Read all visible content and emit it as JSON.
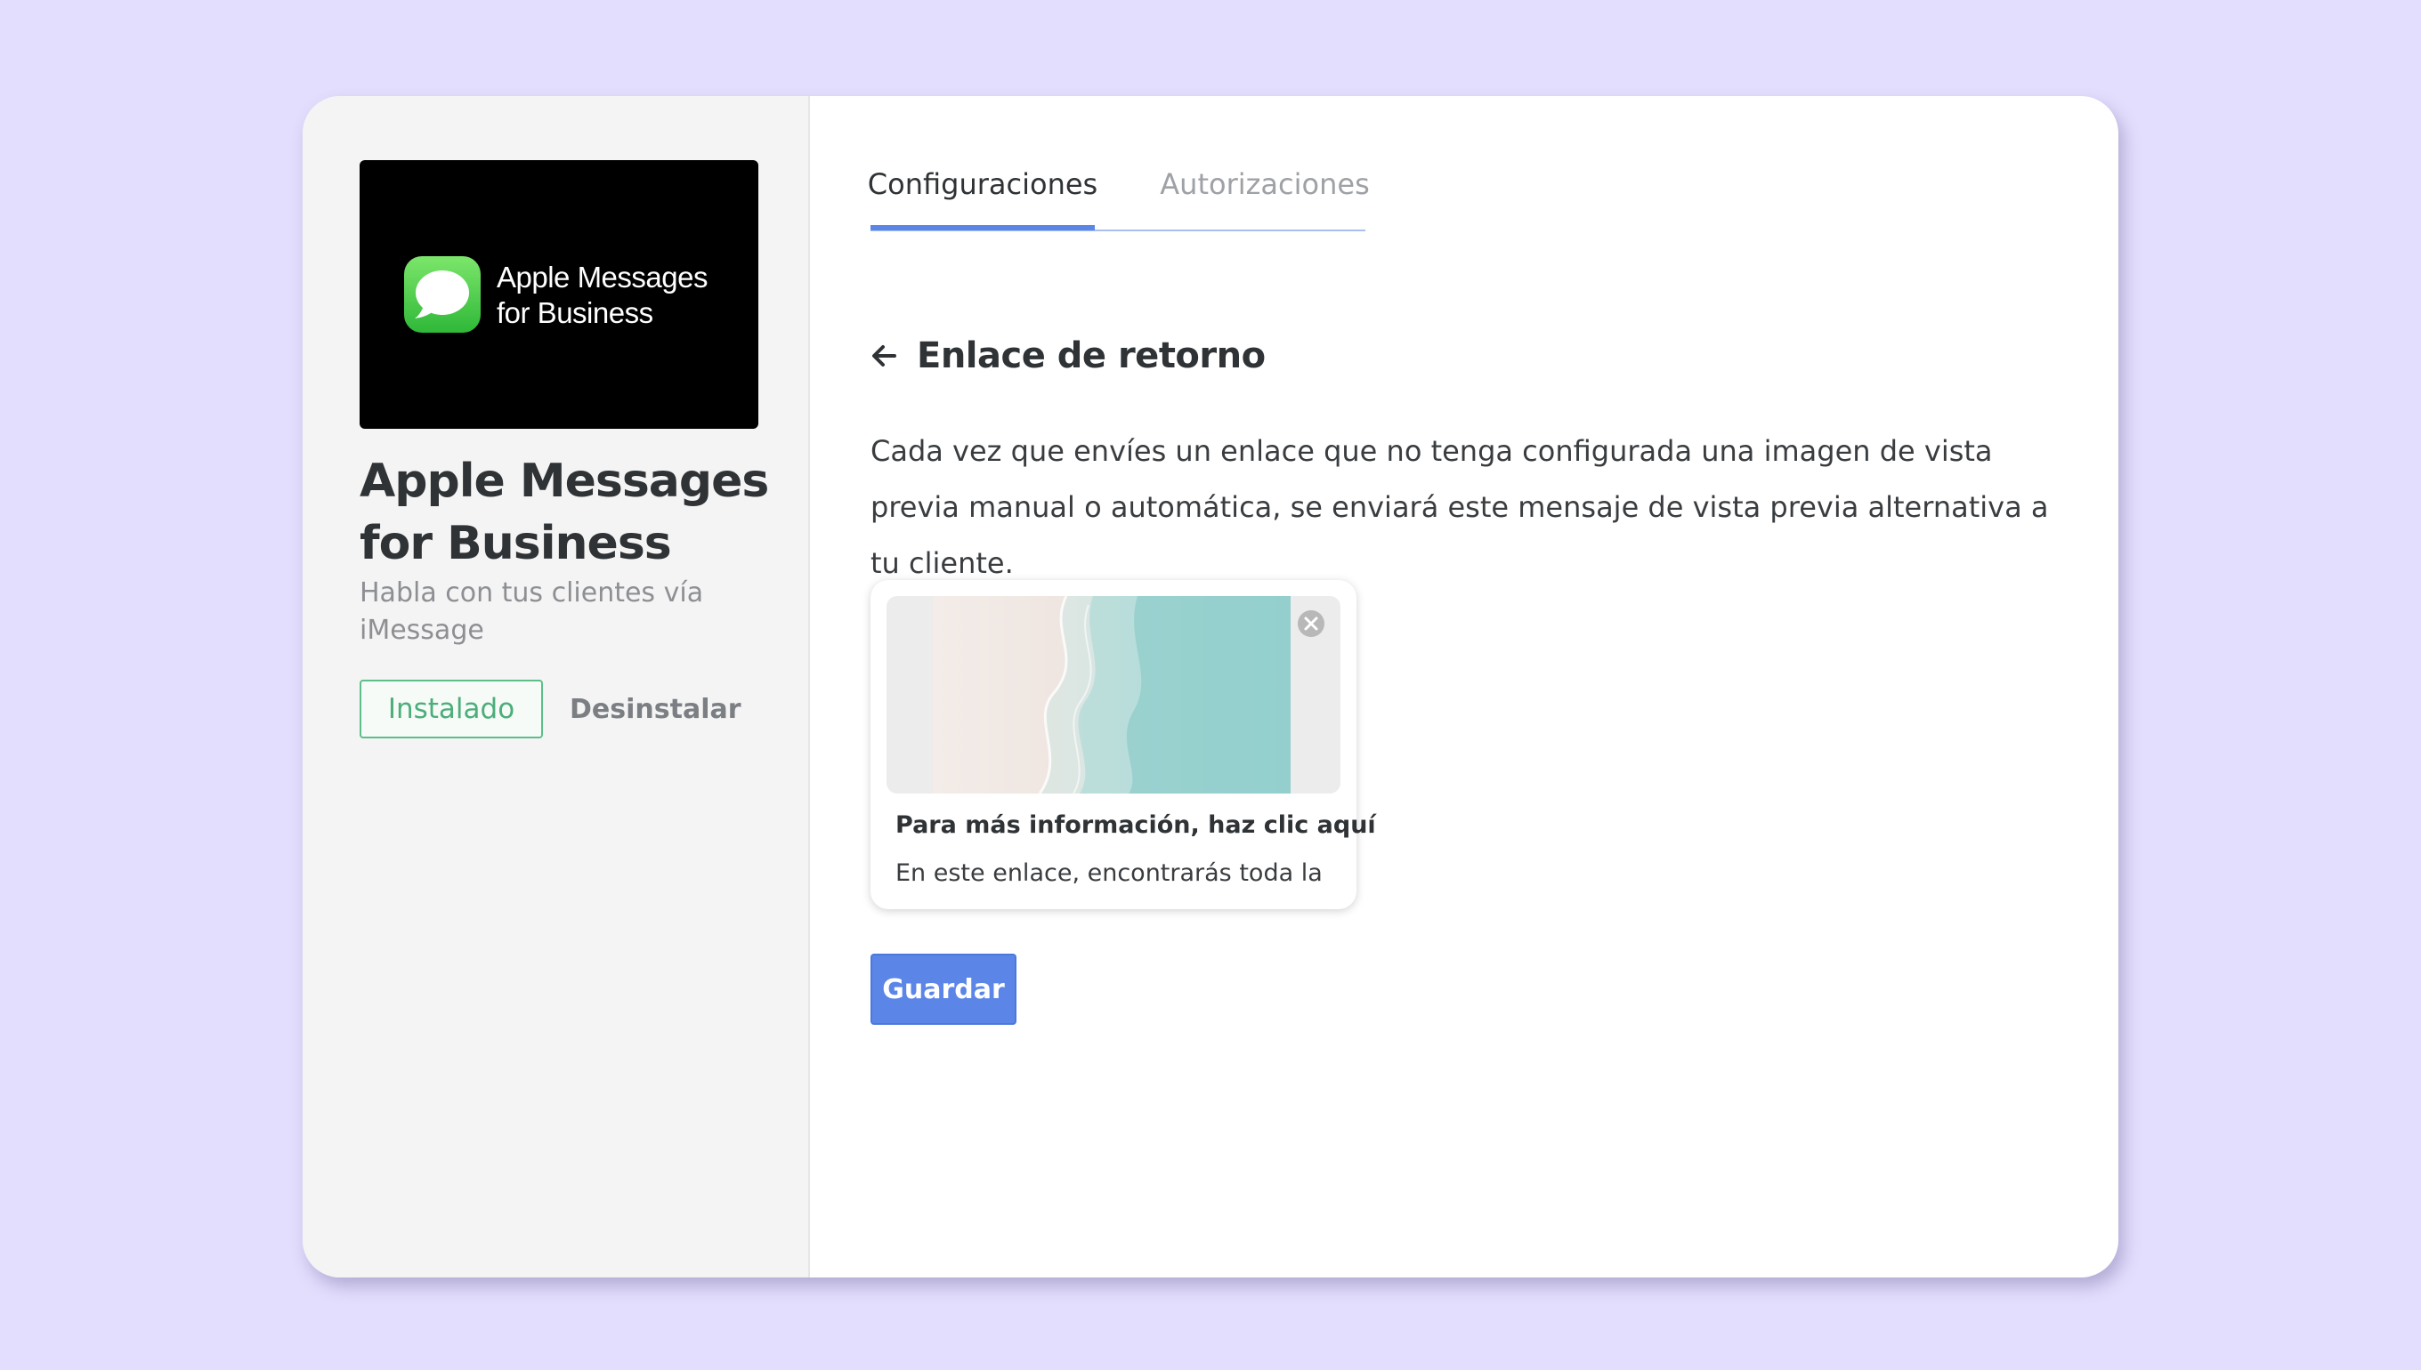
{
  "app": {
    "logo_line1": "Apple Messages",
    "logo_line2": "for Business",
    "title_line1": "Apple Messages",
    "title_line2": "for Business",
    "subtitle": "Habla con tus clientes vía iMessage",
    "installed_label": "Instalado",
    "uninstall_label": "Desinstalar"
  },
  "tabs": [
    {
      "label": "Configuraciones",
      "active": true
    },
    {
      "label": "Autorizaciones",
      "active": false
    }
  ],
  "section": {
    "title": "Enlace de retorno",
    "description": "Cada vez que envíes un enlace que no tenga configurada una imagen de vista previa manual o automática, se enviará este mensaje de vista previa alternativa a tu cliente."
  },
  "preview": {
    "title": "Para más información, haz clic aquí",
    "description": "En este enlace, encontrarás toda la información"
  },
  "actions": {
    "save_label": "Guardar"
  },
  "colors": {
    "background": "#e3defd",
    "accent": "#5b86e8",
    "installed_green": "#4cae7a"
  },
  "icons": {
    "back": "arrow-left-icon",
    "close": "close-circle-icon",
    "messages": "messages-bubble-icon"
  }
}
